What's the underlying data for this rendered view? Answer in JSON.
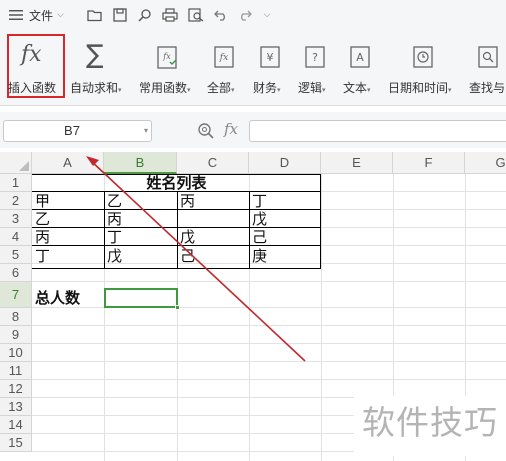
{
  "menubar": {
    "menu_label": "文件",
    "quick_access": [
      "hamburger-menu-icon",
      "open-folder-icon",
      "save-icon",
      "find-icon",
      "print-icon",
      "print-preview-icon",
      "undo-icon",
      "redo-icon",
      "dropdown-icon"
    ]
  },
  "ribbon": {
    "buttons": [
      {
        "label": "插入函数",
        "icon": "fx"
      },
      {
        "label": "自动求和",
        "icon": "∑"
      },
      {
        "label": "常用函数",
        "icon": "fx"
      },
      {
        "label": "全部",
        "icon": "fx"
      },
      {
        "label": "财务",
        "icon": "¥"
      },
      {
        "label": "逻辑",
        "icon": "?"
      },
      {
        "label": "文本",
        "icon": "A"
      },
      {
        "label": "日期和时间",
        "icon": "clock"
      },
      {
        "label": "查找与引",
        "icon": "search"
      }
    ]
  },
  "formula_bar": {
    "name_box": "B7",
    "fx_symbol": "fx",
    "formula": ""
  },
  "sheet": {
    "columns": [
      "A",
      "B",
      "C",
      "D",
      "E",
      "F",
      "G"
    ],
    "rows": [
      "1",
      "2",
      "3",
      "4",
      "5",
      "6",
      "7",
      "8",
      "9",
      "10",
      "11",
      "12",
      "13",
      "14",
      "15"
    ],
    "active_cell": "B7",
    "title": "姓名列表",
    "table": [
      [
        "甲",
        "乙",
        "丙",
        "丁"
      ],
      [
        "乙",
        "丙",
        "",
        "戊"
      ],
      [
        "丙",
        "丁",
        "戊",
        "己"
      ],
      [
        "丁",
        "戊",
        "己",
        "庚"
      ]
    ],
    "total_label": "总人数"
  },
  "annotation": {
    "arrow_color": "#c0282b",
    "box_color": "#d9262b"
  },
  "watermark": "软件技巧"
}
